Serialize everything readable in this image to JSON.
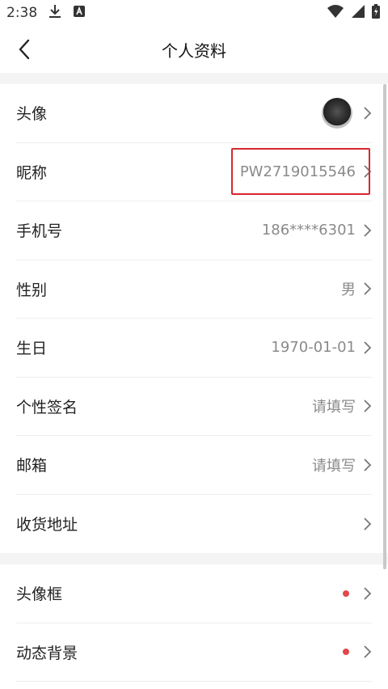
{
  "status_bar": {
    "time": "2:38"
  },
  "nav": {
    "title": "个人资料"
  },
  "profile_rows": [
    {
      "label": "头像",
      "value": ""
    },
    {
      "label": "昵称",
      "value": "PW2719015546"
    },
    {
      "label": "手机号",
      "value": "186****6301"
    },
    {
      "label": "性别",
      "value": "男"
    },
    {
      "label": "生日",
      "value": "1970-01-01"
    },
    {
      "label": "个性签名",
      "value": "请填写"
    },
    {
      "label": "邮箱",
      "value": "请填写"
    },
    {
      "label": "收货地址",
      "value": ""
    }
  ],
  "decor_rows": [
    {
      "label": "头像框"
    },
    {
      "label": "动态背景"
    }
  ],
  "colors": {
    "highlight": "#d7282f",
    "dot": "#e2474b",
    "value_text": "#8a8a8a"
  }
}
